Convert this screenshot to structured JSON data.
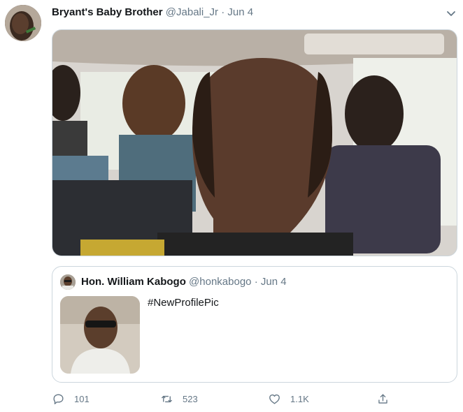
{
  "tweet": {
    "author_name": "Bryant's Baby Brother",
    "author_handle": "@Jabali_Jr",
    "separator": "·",
    "date": "Jun 4"
  },
  "quoted_tweet": {
    "author_name": "Hon. William Kabogo",
    "author_handle": "@honkabogo",
    "separator": "·",
    "date": "Jun 4",
    "text": "#NewProfilePic"
  },
  "actions": {
    "reply_count": "101",
    "retweet_count": "523",
    "like_count": "1.1K"
  },
  "icons": [
    "chevron-down-icon",
    "reply-icon",
    "retweet-icon",
    "like-icon",
    "share-icon"
  ],
  "colors": {
    "text_primary": "#14171a",
    "text_secondary": "#657786",
    "border": "#ccd6dd"
  }
}
